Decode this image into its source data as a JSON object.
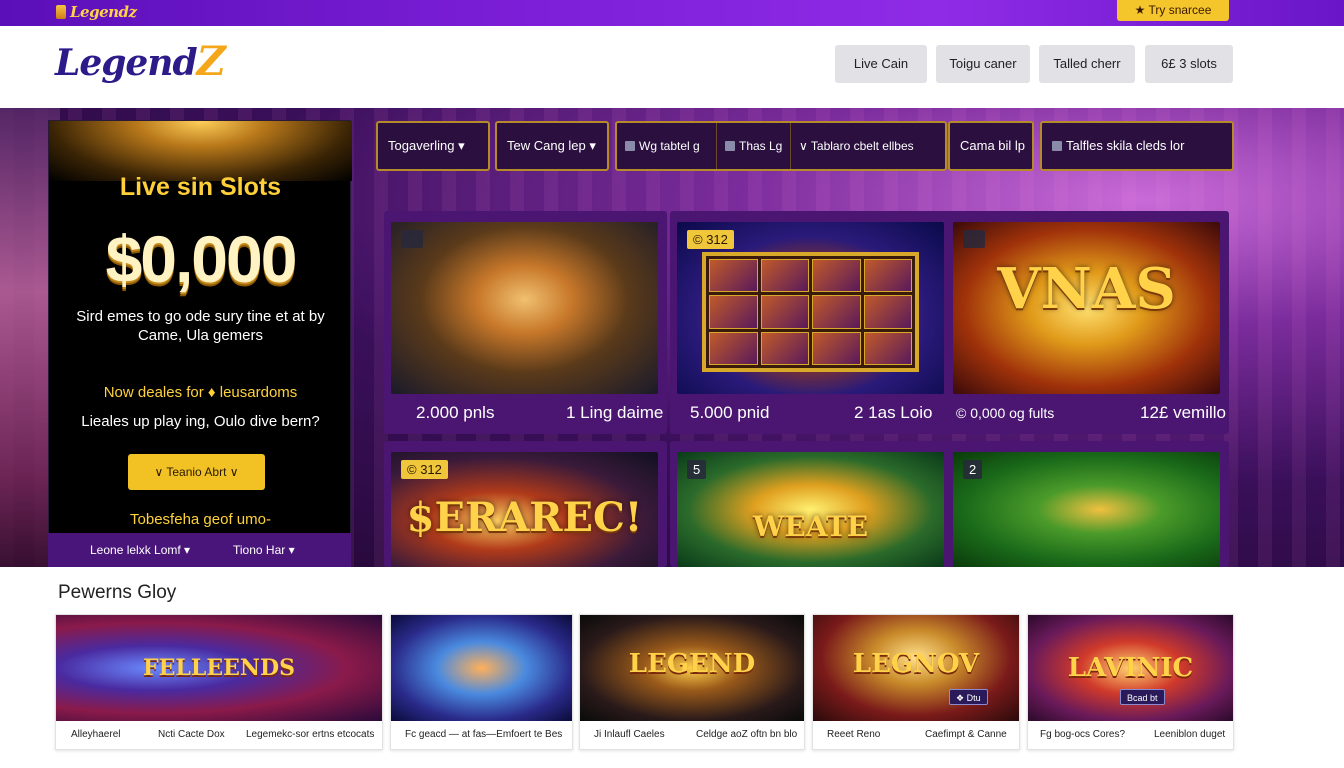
{
  "topbar": {
    "mini_logo": "Legendz",
    "promo_button": "★ Try snarcee"
  },
  "header": {
    "logo_main": "Legend",
    "logo_z": "Z",
    "nav": [
      "Live Cain",
      "Toigu caner",
      "Talled cherr",
      "6£ 3 slots"
    ]
  },
  "promo": {
    "title": "Live sin Slots",
    "amount": "$0,000",
    "subtitle": "Sird emes to go ode sury tine et at by Came, Ula gemers",
    "yellow_line": "Now deales for ♦ leusardoms",
    "white_line": "Lieales up play ing, Oulo dive bern?",
    "cta_label": "∨  Teanio Abrt  ∨",
    "footer_text": "Tobesfeha geof umo-",
    "tabs": [
      "Leone lelxk Lomf ▾",
      "Tiono Har ▾"
    ]
  },
  "filters": {
    "dropdown1": "Togaverling ▾",
    "dropdown2": "Tew Cang lep ▾",
    "group": [
      "Wg tabtel g",
      "Thas Lg",
      "∨ Tablaro cbelt ellbes"
    ],
    "dropdown3": "Cama bil lp",
    "search": "Talfles skila cleds lor"
  },
  "games": [
    {
      "badge": "",
      "art_text": "",
      "left": "2.000 pnls",
      "right": "1 Ling daime"
    },
    {
      "badge": "© 312",
      "art_text": "",
      "left": "5.000 pnid",
      "right": "2 1as Loio"
    },
    {
      "badge": "",
      "art_text": "VNAS",
      "left": "© 0,000 og fults",
      "right": "12£ vemillo"
    },
    {
      "badge": "© 312",
      "art_text": "$ERAREC!",
      "left": "",
      "right": ""
    },
    {
      "badge": "5",
      "art_text": "WEATE",
      "left": "",
      "right": ""
    },
    {
      "badge": "2",
      "art_text": "",
      "left": "",
      "right": ""
    }
  ],
  "bottom": {
    "title": "Pewerns Gloy",
    "cards": [
      {
        "art_text": "FELLEENDS",
        "chip": "",
        "label_left": "Alleyhaerel",
        "label_right": "Ncti Cacte Dox"
      },
      {
        "art_text": "",
        "chip": "",
        "label_left": "Legemekc-sor ertns etcocats",
        "label_right": ""
      },
      {
        "art_text": "LEGEND",
        "chip": "",
        "label_left": "Fc geacd — at fas—Emfoert te Bes",
        "label_right": ""
      },
      {
        "art_text": "LEGNOV",
        "chip": "❖ Dtu",
        "label_left": "Ji Inlaufl Caeles",
        "label_right": "Celdge aoZ oftn bn blo"
      },
      {
        "art_text": "LAVINIC",
        "chip": "Bcad bt",
        "label_left": "Reeet Reno",
        "label_right": "Caefimpt & Canne"
      }
    ],
    "extra_labels": [
      "Fg bog-ocs Cores?",
      "Leeniblon duget"
    ]
  }
}
